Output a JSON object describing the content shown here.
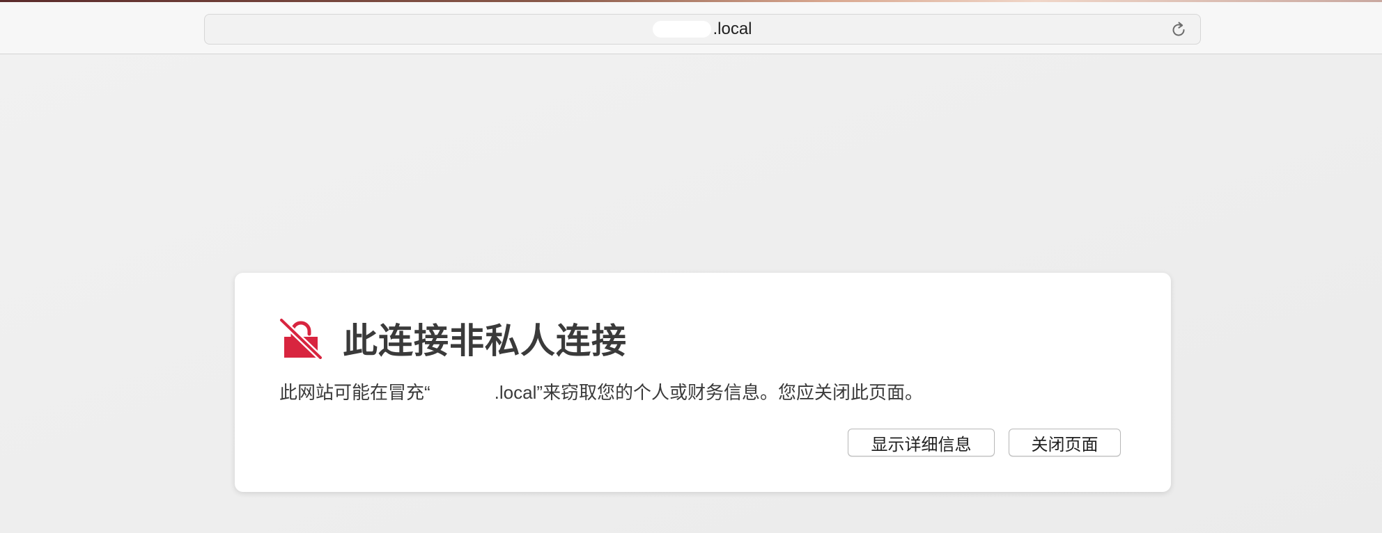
{
  "browser": {
    "address_bar": {
      "domain_suffix": ".local",
      "reload_icon": "reload-icon"
    }
  },
  "warning": {
    "icon": "broken-lock-icon",
    "icon_color": "#d8253f",
    "title": "此连接非私人连接",
    "message_prefix": "此网站可能在冒充“",
    "message_domain_suffix": ".local",
    "message_suffix": "”来窃取您的个人或财务信息。您应关闭此页面。",
    "buttons": {
      "show_details": "显示详细信息",
      "close_page": "关闭页面"
    }
  }
}
